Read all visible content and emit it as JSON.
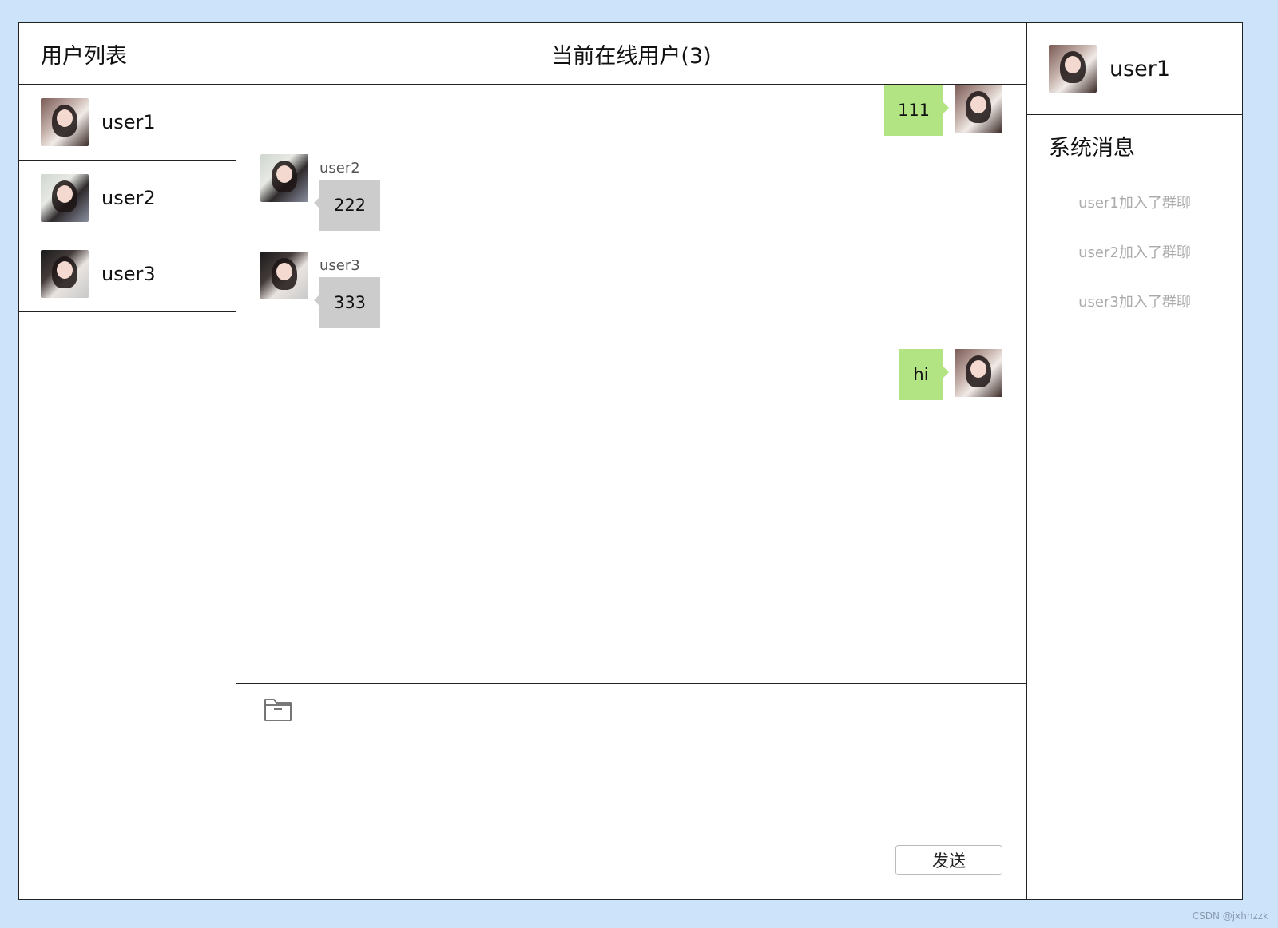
{
  "left": {
    "title": "用户列表",
    "users": [
      {
        "name": "user1",
        "avatar": "avatar-user1"
      },
      {
        "name": "user2",
        "avatar": "avatar-user2"
      },
      {
        "name": "user3",
        "avatar": "avatar-user3"
      }
    ]
  },
  "center": {
    "title": "当前在线用户(3)",
    "messages": [
      {
        "sender": "user1",
        "mine": true,
        "text": "111"
      },
      {
        "sender": "user2",
        "mine": false,
        "text": "222"
      },
      {
        "sender": "user3",
        "mine": false,
        "text": "333"
      },
      {
        "sender": "user1",
        "mine": true,
        "text": "hi"
      }
    ],
    "folder_icon": "folder-icon",
    "send_label": "发送"
  },
  "right": {
    "current_user": "user1",
    "system_title": "系统消息",
    "system_messages": [
      "user1加入了群聊",
      "user2加入了群聊",
      "user3加入了群聊"
    ]
  },
  "watermark": "CSDN @jxhhzzk",
  "colors": {
    "page_background": "#cde3fa",
    "own_bubble": "#b3e483",
    "other_bubble": "#cccccc",
    "system_text": "#aaaaaa"
  }
}
